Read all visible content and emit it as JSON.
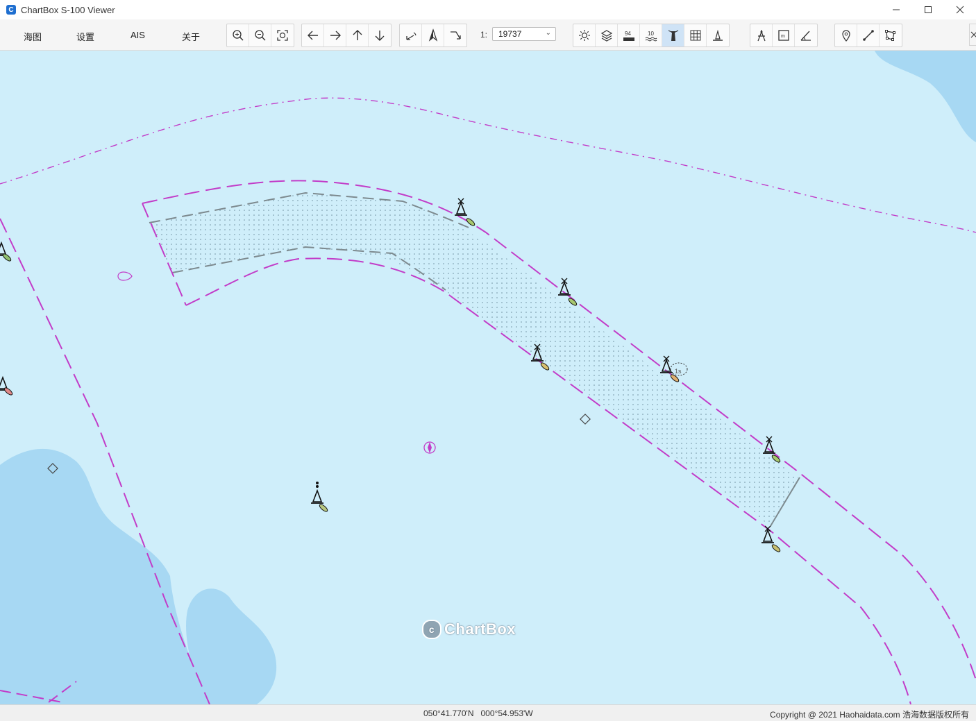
{
  "window": {
    "title": "ChartBox S-100 Viewer",
    "icon_letter": "C",
    "controls": [
      "minimize-icon",
      "maximize-icon",
      "close-icon"
    ]
  },
  "menu": {
    "items": [
      {
        "label": "海图"
      },
      {
        "label": "设置"
      },
      {
        "label": "AIS"
      },
      {
        "label": "关于"
      }
    ]
  },
  "toolbar": {
    "zoom_group": [
      "zoom-in-icon",
      "zoom-out-icon",
      "zoom-fit-icon"
    ],
    "pan_group": [
      "arrow-left-icon",
      "arrow-right-icon",
      "arrow-up-icon",
      "arrow-down-icon"
    ],
    "rotate_group": [
      "rotate-left-icon",
      "north-up-icon",
      "rotate-right-icon"
    ],
    "scale_prefix": "1:",
    "scale_value": "19737",
    "display_group": [
      "brightness-icon",
      "layers-icon",
      "depth-soundings-icon",
      "depth-contours-icon",
      "lighthouse-icon",
      "grid-icon",
      "buoy-icon"
    ],
    "active_display_item": "lighthouse-icon",
    "measure_group": [
      "compass-icon",
      "frame-icon",
      "angle-icon"
    ],
    "route_group": [
      "place-pin-icon",
      "line-measure-icon",
      "polygon-area-icon"
    ]
  },
  "map": {
    "watermark": "ChartBox",
    "colors": {
      "sea": "#cfeefa",
      "shallow": "#a7d8f3",
      "boundary": "#c23cc8",
      "fairway": "#7d8a8f",
      "buoy_green": "#a8c870",
      "buoy_red": "#e08a8a",
      "buoy_yellow": "#d8c070"
    },
    "soundings": [
      "1s"
    ]
  },
  "status": {
    "latitude": "050°41.770'N",
    "longitude": "000°54.953'W",
    "copyright": "Copyright @ 2021 Haohaidata.com 浩海数据版权所有"
  }
}
